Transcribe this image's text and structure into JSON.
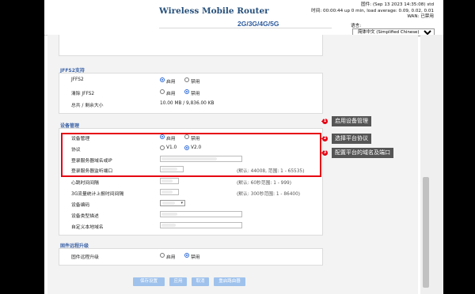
{
  "header": {
    "brand": "Wireless Mobile Router",
    "subtitle": "2G/3G/4G/5G",
    "firmware": "固件: (Sep 13 2023 14:35:08) std",
    "time": "时间: 00:00:44 up 0 min, load average: 0.09, 0.02, 0.01",
    "wan": "WAN: 已禁用",
    "language_label": "语言:",
    "language_value": "简体中文 (Simplified Chinese)"
  },
  "jffs": {
    "title": "JFFS2支持",
    "rows": [
      {
        "label": "JFFS2",
        "opt1": "启用",
        "opt2": "禁用",
        "selected": 1
      },
      {
        "label": "清除 JFFS2",
        "opt1": "启用",
        "opt2": "禁用",
        "selected": 2
      }
    ],
    "total_label": "总共 / 剩余大小",
    "total_value": "10.00 MB / 9,836.00 KB"
  },
  "device_mgmt": {
    "title": "设备管理",
    "mgmt_label": "设备管理",
    "mgmt_opt1": "启用",
    "mgmt_opt2": "禁用",
    "protocol_label": "协议",
    "protocol_opt1": "V1.0",
    "protocol_opt2": "V2.0",
    "server_label": "登录服务器域名或IP",
    "port_label": "登录服务器监听端口",
    "port_hint": "(默认: 44008, 范围: 1 - 65535)",
    "heartbeat_label": "心跳时间间隔",
    "heartbeat_hint": "(默认: 60秒范围: 1 - 999)",
    "traffic_label": "3G流量统计上报时间间隔",
    "traffic_hint": "(默认: 300秒范围: 1 - 86400)",
    "encoding_label": "设备编码",
    "type_label": "设备类型描述",
    "domain_label": "自定义本地域名"
  },
  "upgrade": {
    "title": "固件远程升级",
    "label": "固件远程升级",
    "opt1": "启用",
    "opt2": "禁用"
  },
  "buttons": {
    "save": "保存设置",
    "apply": "应用",
    "cancel": "取消",
    "reboot": "重启路由器"
  },
  "annotations": {
    "n1": "1",
    "n2": "2",
    "n3": "3",
    "a1": "启用设备管理",
    "a2": "选择平台协议",
    "a3": "配置平台的域名及端口"
  },
  "colors": {
    "highlight": "#e60012",
    "section_title": "#3d64a8",
    "button": "#9fc2ec",
    "callout_bg": "#555555"
  }
}
